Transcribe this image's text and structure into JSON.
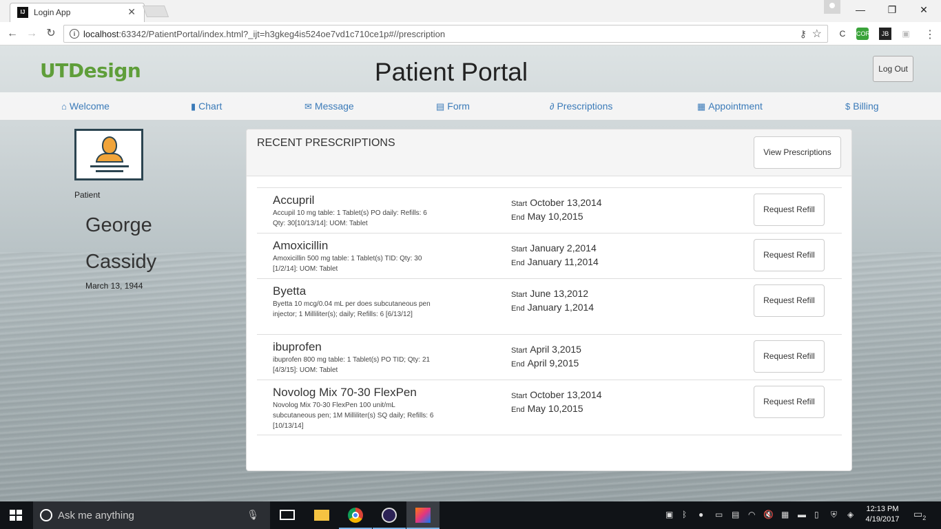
{
  "browser": {
    "tab_title": "Login App",
    "tab_favicon": "IJ",
    "url_host": "localhost",
    "url_rest": ":63342/PatientPortal/index.html?_ijt=h3gkeg4is524oe7vd1c710ce1p#//prescription",
    "extensions": [
      "JB"
    ]
  },
  "header": {
    "logo": "UTDesign",
    "title": "Patient Portal",
    "logout_label": "Log Out"
  },
  "nav": [
    {
      "label": "Welcome",
      "icon": "home-icon"
    },
    {
      "label": "Chart",
      "icon": "bar-chart-icon"
    },
    {
      "label": "Message",
      "icon": "envelope-icon"
    },
    {
      "label": "Form",
      "icon": "file-icon"
    },
    {
      "label": "Prescriptions",
      "icon": "link-icon"
    },
    {
      "label": "Appointment",
      "icon": "calendar-icon"
    },
    {
      "label": "Billing",
      "icon": "dollar-icon"
    }
  ],
  "patient": {
    "role": "Patient",
    "first_name": "George",
    "last_name": "Cassidy",
    "dob": "March 13, 1944"
  },
  "prescriptions": {
    "title": "RECENT PRESCRIPTIONS",
    "view_label": "View Prescriptions",
    "start_label": "Start",
    "end_label": "End",
    "refill_label": "Request Refill",
    "items": [
      {
        "name": "Accupril",
        "desc": "Accupil 10 mg table: 1 Tablet(s) PO daily: Refills: 6 Qty: 30[10/13/14]: UOM: Tablet",
        "start": "October 13,2014",
        "end": "May 10,2015"
      },
      {
        "name": "Amoxicillin",
        "desc": "Amoxicillin 500 mg table: 1 Tablet(s) TID: Qty: 30 [1/2/14]: UOM: Tablet",
        "start": "January 2,2014",
        "end": "January 11,2014"
      },
      {
        "name": "Byetta",
        "desc": "Byetta 10 mcg/0.04 mL per does subcutaneous pen injector; 1 Milliliter(s); daily; Refills: 6 [6/13/12]",
        "start": "June 13,2012",
        "end": "January 1,2014"
      },
      {
        "name": "ibuprofen",
        "desc": "ibuprofen 800 mg table: 1 Tablet(s) PO TID; Qty: 21 [4/3/15]: UOM: Tablet",
        "start": "April 3,2015",
        "end": "April 9,2015"
      },
      {
        "name": "Novolog Mix 70-30 FlexPen",
        "desc": "Novolog Mix 70-30 FlexPen 100 unit/mL subcutaneous pen; 1M Milliliter(s) SQ daily; Refills: 6 [10/13/14]",
        "start": "October 13,2014",
        "end": "May 10,2015"
      }
    ]
  },
  "taskbar": {
    "search_placeholder": "Ask me anything",
    "time": "12:13 PM",
    "date": "4/19/2017",
    "notifications": "2"
  }
}
